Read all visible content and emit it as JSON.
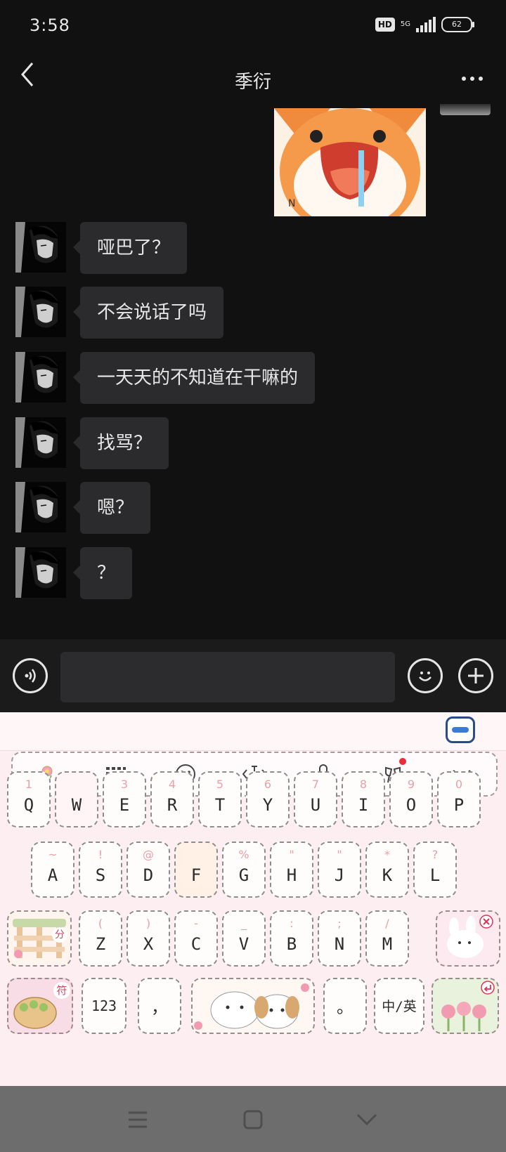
{
  "status_bar": {
    "time": "3:58",
    "hd": "HD",
    "network": "5G",
    "battery": "62"
  },
  "header": {
    "title": "季衍"
  },
  "messages": [
    {
      "text": "哑巴了？"
    },
    {
      "text": "不会说话了吗"
    },
    {
      "text": "一天天的不知道在干嘛的"
    },
    {
      "text": "找骂？"
    },
    {
      "text": "嗯？"
    },
    {
      "text": "？"
    }
  ],
  "input": {
    "value": "",
    "placeholder": ""
  },
  "keyboard": {
    "row1": [
      {
        "sub": "1",
        "key": "Q"
      },
      {
        "sub": "",
        "key": "W"
      },
      {
        "sub": "3",
        "key": "E"
      },
      {
        "sub": "4",
        "key": "R"
      },
      {
        "sub": "5",
        "key": "T"
      },
      {
        "sub": "6",
        "key": "Y"
      },
      {
        "sub": "7",
        "key": "U"
      },
      {
        "sub": "8",
        "key": "I"
      },
      {
        "sub": "9",
        "key": "O"
      },
      {
        "sub": "0",
        "key": "P"
      }
    ],
    "row2": [
      {
        "sub": "~",
        "key": "A"
      },
      {
        "sub": "!",
        "key": "S"
      },
      {
        "sub": "@",
        "key": "D"
      },
      {
        "sub": "",
        "key": "F"
      },
      {
        "sub": "%",
        "key": "G"
      },
      {
        "sub": "\"",
        "key": "H"
      },
      {
        "sub": "\"",
        "key": "J"
      },
      {
        "sub": "*",
        "key": "K"
      },
      {
        "sub": "?",
        "key": "L"
      }
    ],
    "row3": [
      {
        "sub": "(",
        "key": "Z"
      },
      {
        "sub": ")",
        "key": "X"
      },
      {
        "sub": "-",
        "key": "C"
      },
      {
        "sub": "_",
        "key": "V"
      },
      {
        "sub": ":",
        "key": "B"
      },
      {
        "sub": ";",
        "key": "N"
      },
      {
        "sub": "/",
        "key": "M"
      }
    ],
    "fen_label": "分",
    "fu_label": "符",
    "num_label": "123",
    "comma": "，",
    "period": "。",
    "lang_label": "中/英"
  },
  "colors": {
    "background": "#111112",
    "bubble": "#2b2b2d",
    "keyboard_bg": "#fdeef2",
    "notify_dot": "#ea2d3b"
  }
}
